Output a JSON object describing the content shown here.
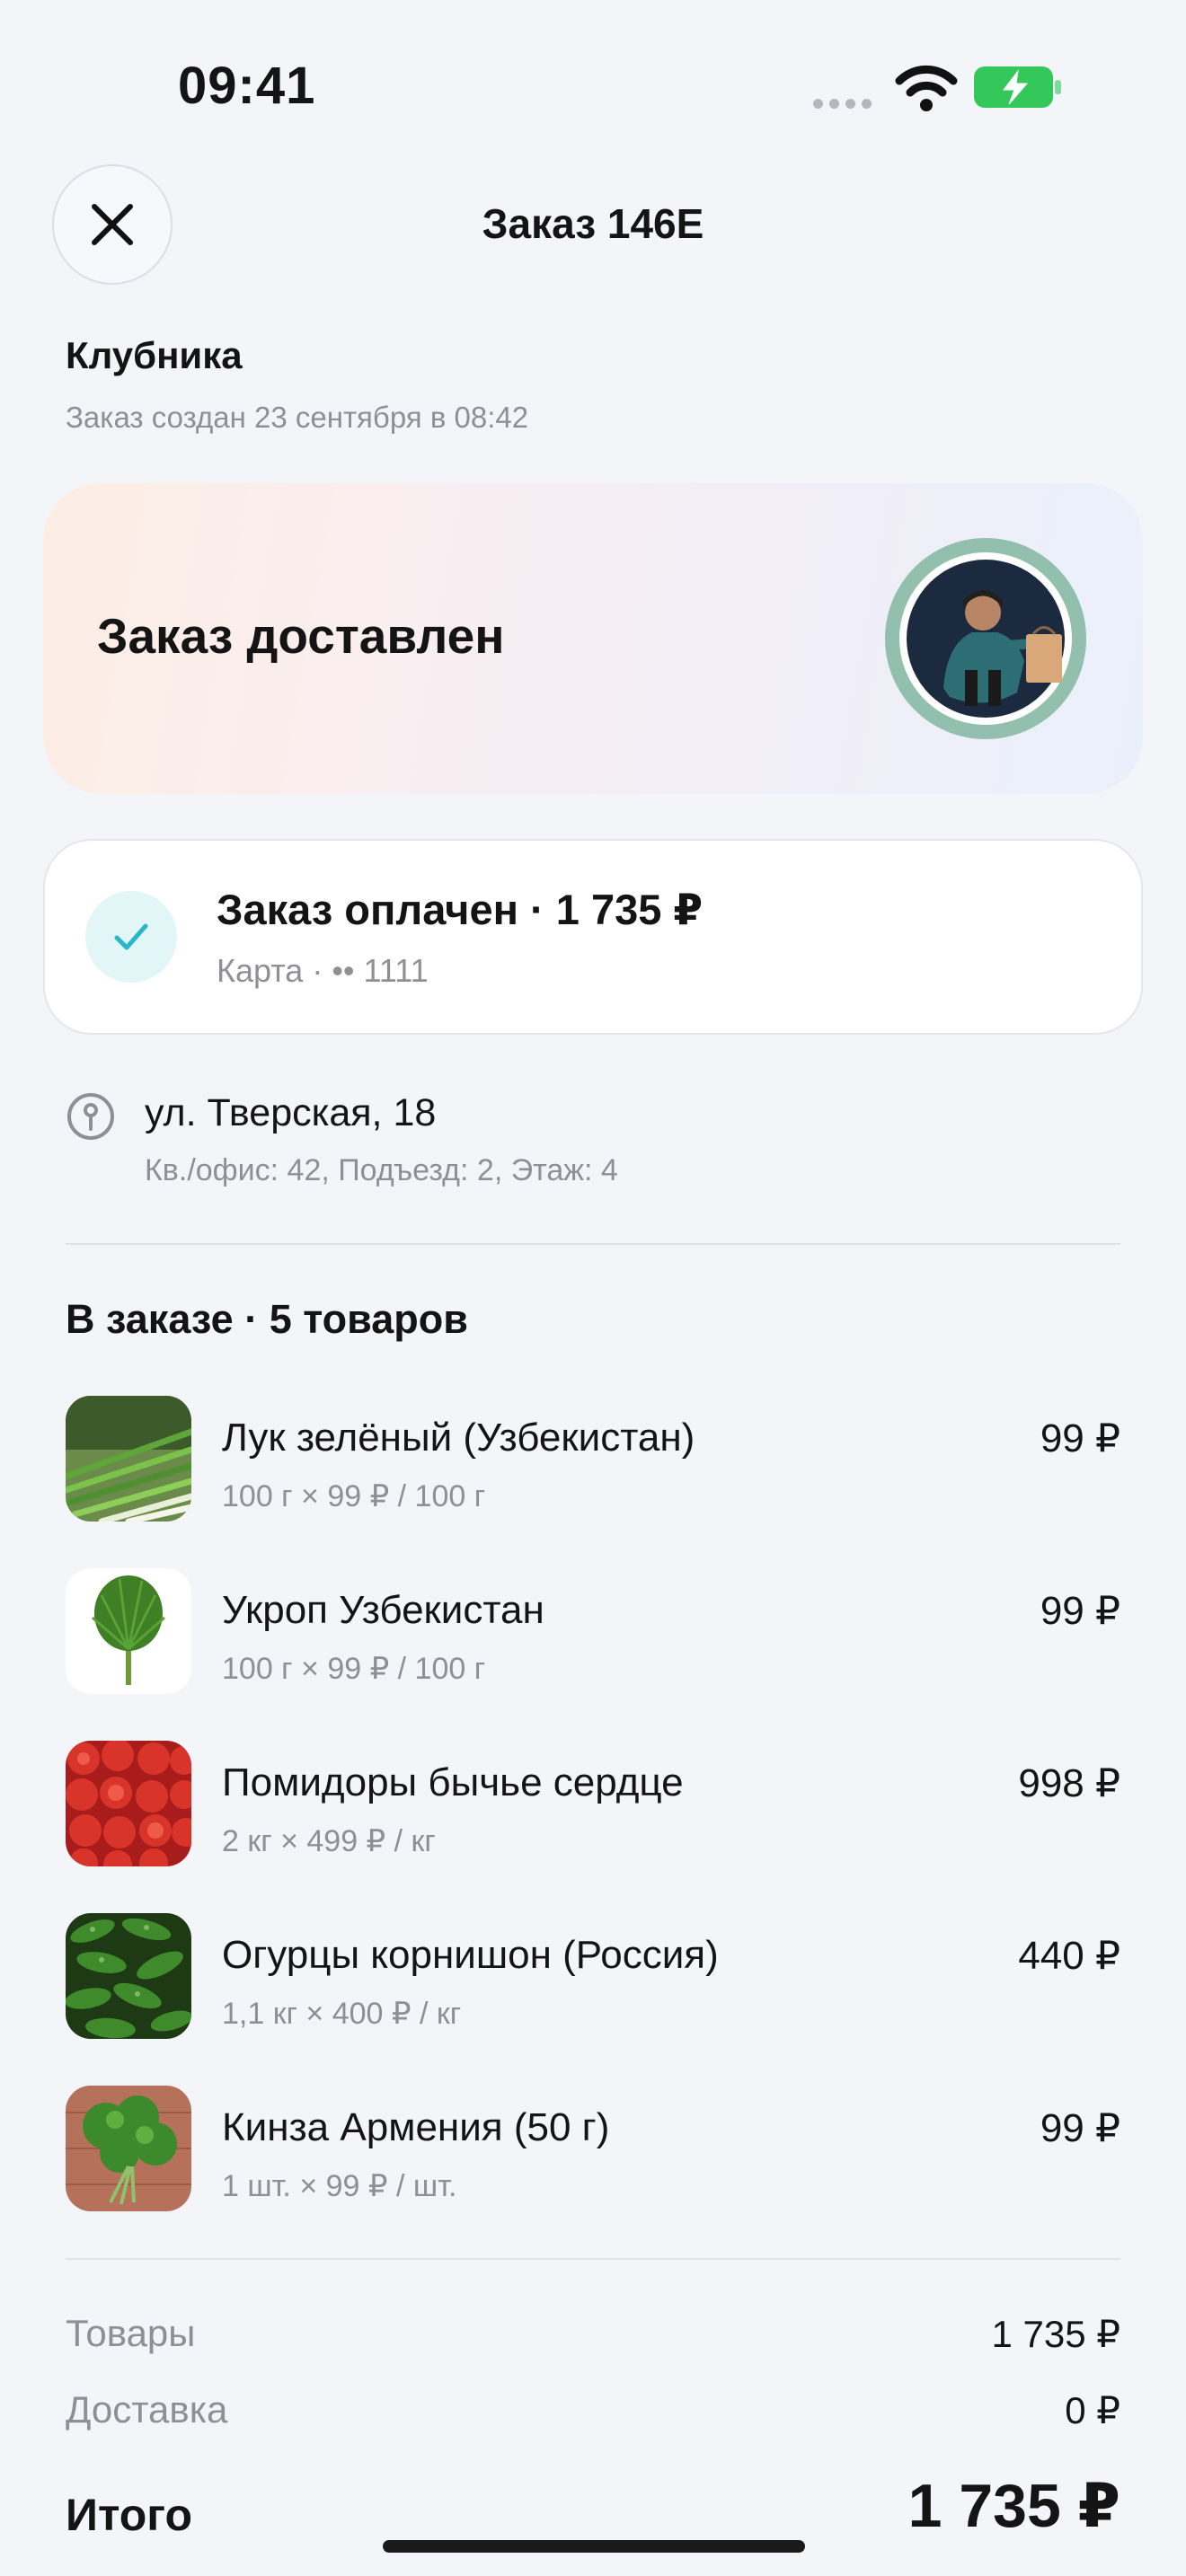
{
  "status_bar": {
    "time": "09:41"
  },
  "header": {
    "title": "Заказ 146E"
  },
  "store": {
    "name": "Клубника",
    "created": "Заказ создан 23 сентября в 08:42"
  },
  "banner": {
    "status": "Заказ доставлен"
  },
  "payment": {
    "title": "Заказ оплачен · 1 735 ₽",
    "method": "Карта · •• 1111"
  },
  "address": {
    "street": "ул. Тверская, 18",
    "details": "Кв./офис: 42, Подъезд: 2, Этаж: 4"
  },
  "order": {
    "section_title": "В заказе · 5 товаров",
    "items": [
      {
        "name": "Лук зелёный (Узбекистан)",
        "qty": "100 г × 99 ₽ / 100 г",
        "price": "99 ₽"
      },
      {
        "name": "Укроп Узбекистан",
        "qty": "100 г × 99 ₽ / 100 г",
        "price": "99 ₽"
      },
      {
        "name": "Помидоры бычье сердце",
        "qty": "2 кг × 499 ₽ / кг",
        "price": "998 ₽"
      },
      {
        "name": "Огурцы корнишон (Россия)",
        "qty": "1,1 кг × 400 ₽ / кг",
        "price": "440 ₽"
      },
      {
        "name": "Кинза Армения (50 г)",
        "qty": "1 шт. × 99 ₽ / шт.",
        "price": "99 ₽"
      }
    ]
  },
  "totals": {
    "goods_label": "Товары",
    "goods_value": "1 735 ₽",
    "delivery_label": "Доставка",
    "delivery_value": "0 ₽",
    "total_label": "Итого",
    "total_value": "1 735 ₽"
  },
  "colors": {
    "accent": "#29b6c8",
    "battery": "#34c759",
    "muted": "#8e9096"
  }
}
